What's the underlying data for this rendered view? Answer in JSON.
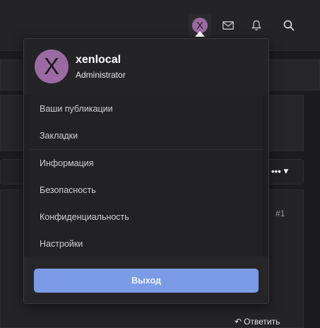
{
  "topbar": {
    "avatar_letter": "X",
    "icons": [
      "avatar-button",
      "mail-icon",
      "bell-icon",
      "search-icon"
    ]
  },
  "popup": {
    "avatar_letter": "X",
    "username": "xenlocal",
    "role": "Administrator",
    "menu_group1": [
      "Ваши публикации",
      "Закладки"
    ],
    "menu_group2": [
      "Информация",
      "Безопасность",
      "Конфиденциальность",
      "Настройки"
    ],
    "logout_label": "Выход"
  },
  "post": {
    "number": "#1",
    "reply_label": "Ответить"
  },
  "colors": {
    "avatar": "#9c6aa3",
    "accent": "#7c9be6"
  }
}
